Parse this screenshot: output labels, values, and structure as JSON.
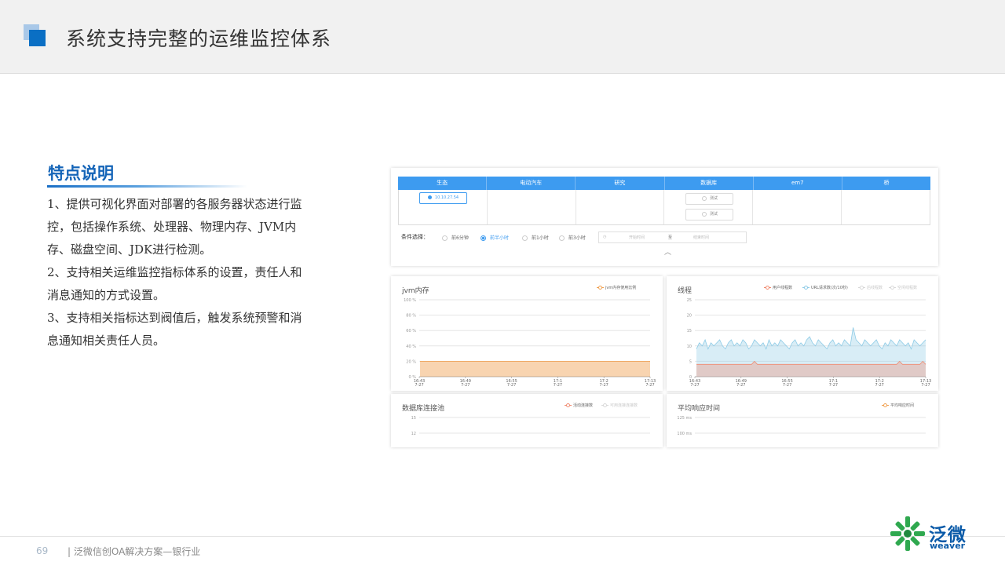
{
  "header": {
    "title": "系统支持完整的运维监控体系"
  },
  "features": {
    "title": "特点说明",
    "lines": [
      "1、提供可视化界面对部署的各服务器状态进行监",
      "控，包括操作系统、处理器、物理内存、JVM内",
      "存、磁盘空间、JDK进行检测。",
      "2、支持相关运维监控指标体系的设置，责任人和",
      "消息通知的方式设置。",
      "3、支持相关指标达到阀值后，触发系统预警和消",
      "息通知相关责任人员。"
    ]
  },
  "server_table": {
    "headers": [
      "生态",
      "电动汽车",
      "研究",
      "数据库",
      "em7",
      "桥"
    ],
    "ip_button": "10.10.27.54",
    "db_buttons": [
      "测试",
      "测试"
    ]
  },
  "conditions": {
    "label": "条件选择：",
    "options": [
      "前6分钟",
      "前半小时",
      "前1小时",
      "前3小时"
    ],
    "selected": "前半小时",
    "start_placeholder": "开始时间",
    "range_sep": "至",
    "end_placeholder": "结束时间"
  },
  "x_ticks": [
    "16:43\n7-27",
    "16:49\n7-27",
    "16:55\n7-27",
    "17:1\n7-27",
    "17:2\n7-27",
    "17:13\n7-27"
  ],
  "chart_data": [
    {
      "type": "area",
      "title": "jvm内存",
      "legend": [
        "jvm内存使用比例"
      ],
      "y_ticks": [
        "100 %",
        "80 %",
        "60 %",
        "40 %",
        "20 %",
        "0 %"
      ],
      "ylim": [
        0,
        100
      ],
      "series": [
        {
          "name": "jvm内存使用比例",
          "values": [
            20,
            20,
            20,
            20,
            20,
            20,
            20,
            20,
            20,
            20,
            20,
            20,
            20,
            20,
            20,
            20,
            20,
            20,
            20,
            20,
            20,
            20,
            20,
            20,
            20,
            20,
            20,
            20,
            20,
            20
          ],
          "color": "#f0a050"
        }
      ]
    },
    {
      "type": "line",
      "title": "线程",
      "legend": [
        "用户线程数",
        "URL请求数(次/10秒)",
        "后线程数",
        "空闲线程数"
      ],
      "y_ticks": [
        "25",
        "20",
        "15",
        "10",
        "5",
        "0"
      ],
      "ylim": [
        0,
        25
      ],
      "series": [
        {
          "name": "URL请求数(次/10秒)",
          "values": [
            9,
            11,
            10,
            12,
            9,
            11,
            10,
            11,
            12,
            10,
            9,
            11,
            12,
            10,
            11,
            10,
            12,
            11,
            9,
            10,
            12,
            11,
            10,
            11,
            9,
            12,
            10,
            11,
            10,
            12,
            11,
            10,
            9,
            11,
            12,
            10,
            11,
            10,
            12,
            13,
            11,
            10,
            12,
            11,
            10,
            9,
            11,
            12,
            10,
            11,
            10,
            12,
            11,
            10,
            16,
            12,
            11,
            10,
            12,
            11,
            10,
            11,
            12,
            10,
            9,
            11,
            10,
            12,
            11,
            10,
            12,
            11,
            10,
            11,
            9,
            12,
            11,
            10,
            11,
            12
          ],
          "color": "#8ecbe6"
        },
        {
          "name": "用户线程数",
          "values": [
            4,
            4,
            4,
            4,
            4,
            4,
            4,
            4,
            4,
            4,
            4,
            4,
            4,
            4,
            4,
            4,
            4,
            4,
            4,
            4,
            5,
            4,
            4,
            4,
            4,
            4,
            4,
            4,
            4,
            4,
            4,
            4,
            4,
            4,
            4,
            4,
            4,
            4,
            4,
            4,
            4,
            4,
            4,
            4,
            4,
            4,
            4,
            4,
            4,
            4,
            4,
            4,
            4,
            4,
            4,
            4,
            4,
            4,
            4,
            4,
            4,
            4,
            4,
            4,
            4,
            4,
            4,
            4,
            4,
            4,
            5,
            4,
            4,
            4,
            4,
            4,
            4,
            4,
            5,
            4
          ],
          "color": "#f08a70"
        }
      ]
    },
    {
      "type": "line",
      "title": "数据库连接池",
      "legend": [
        "活动连接数",
        "可用连接连接数"
      ],
      "y_ticks": [
        "15",
        "12"
      ],
      "ylim": [
        0,
        15
      ],
      "series": [
        {
          "name": "活动连接数",
          "values": [],
          "color": "#f08a70"
        }
      ]
    },
    {
      "type": "line",
      "title": "平均响应时间",
      "legend": [
        "平均响应时间"
      ],
      "y_ticks": [
        "125 ms",
        "100 ms"
      ],
      "ylim": [
        0,
        125
      ],
      "series": [
        {
          "name": "平均响应时间",
          "values": [],
          "color": "#f0a050"
        }
      ]
    }
  ],
  "footer": {
    "page": "69",
    "text": "| 泛微信创OA解决方案—银行业"
  },
  "brand": {
    "name_cn": "泛微",
    "name_en": "weaver"
  }
}
